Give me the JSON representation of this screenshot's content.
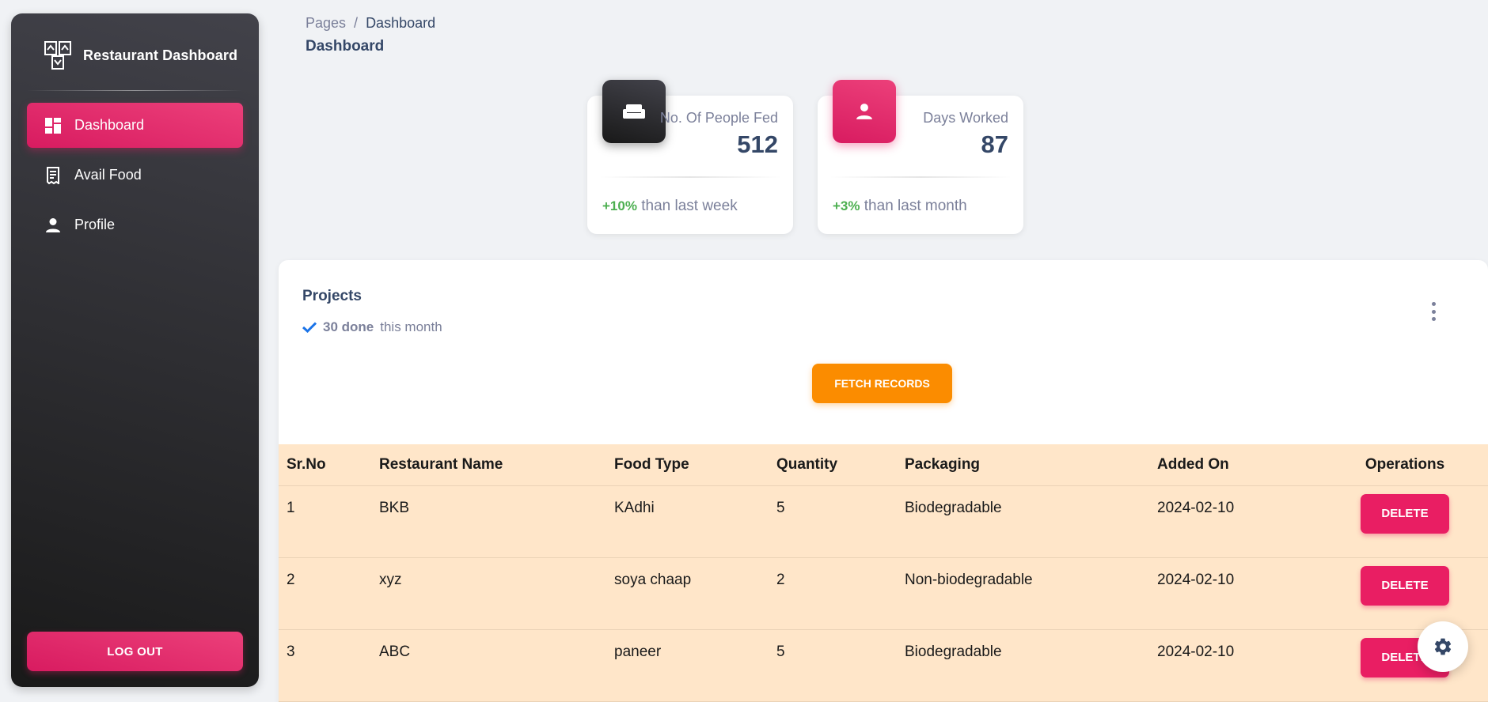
{
  "sidebar": {
    "brand": "Restaurant Dashboard",
    "items": [
      {
        "label": "Dashboard",
        "icon": "dashboard-icon",
        "active": true
      },
      {
        "label": "Avail Food",
        "icon": "receipt-icon",
        "active": false
      },
      {
        "label": "Profile",
        "icon": "person-icon",
        "active": false
      }
    ],
    "logout_label": "LOG OUT"
  },
  "header": {
    "breadcrumb": [
      "Pages",
      "/",
      "Dashboard"
    ],
    "title": "Dashboard"
  },
  "stats": [
    {
      "label": "No. Of People Fed",
      "value": "512",
      "pct": "+10%",
      "note": "than last week",
      "icon": "weekend-icon"
    },
    {
      "label": "Days Worked",
      "value": "87",
      "pct": "+3%",
      "note": "than last month",
      "icon": "person-icon"
    }
  ],
  "projects": {
    "title": "Projects",
    "done": "30 done",
    "done_suffix": "this month",
    "fetch_label": "FETCH RECORDS"
  },
  "table": {
    "headers": [
      "Sr.No",
      "Restaurant Name",
      "Food Type",
      "Quantity",
      "Packaging",
      "Added On",
      "Operations"
    ],
    "rows": [
      {
        "sr": "1",
        "name": "BKB",
        "food": "KAdhi",
        "qty": "5",
        "pack": "Biodegradable",
        "date": "2024-02-10",
        "op": "DELETE"
      },
      {
        "sr": "2",
        "name": "xyz",
        "food": "soya chaap",
        "qty": "2",
        "pack": "Non-biodegradable",
        "date": "2024-02-10",
        "op": "DELETE"
      },
      {
        "sr": "3",
        "name": "ABC",
        "food": "paneer",
        "qty": "5",
        "pack": "Biodegradable",
        "date": "2024-02-10",
        "op": "DELETE"
      }
    ]
  },
  "colors": {
    "primary": "#e91e63",
    "dark": "#191919",
    "warning": "#fb8c00",
    "success": "#4caf50",
    "table_bg": "#ffe6c9"
  }
}
